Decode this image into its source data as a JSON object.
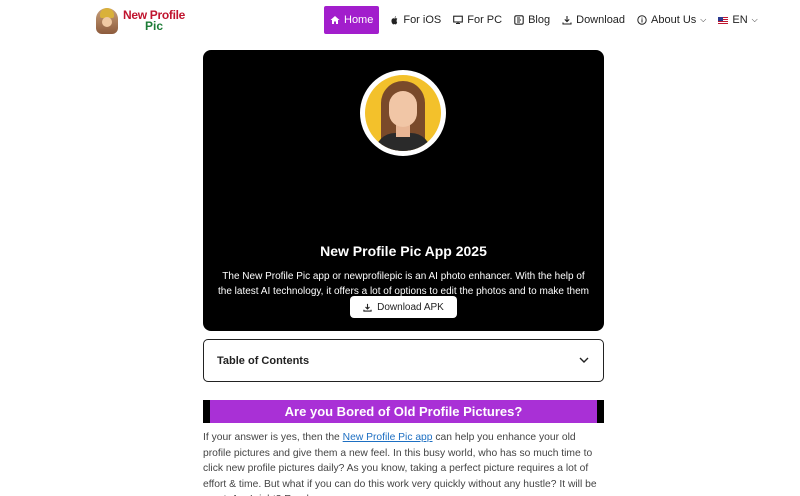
{
  "header": {
    "logo": {
      "line1": "New Profile",
      "line2": "Pic"
    },
    "nav": [
      {
        "label": "Home",
        "icon": "home-icon"
      },
      {
        "label": "For iOS",
        "icon": "apple-icon"
      },
      {
        "label": "For PC",
        "icon": "monitor-icon"
      },
      {
        "label": "Blog",
        "icon": "blog-icon"
      },
      {
        "label": "Download",
        "icon": "download-icon"
      },
      {
        "label": "About Us",
        "icon": "info-icon"
      },
      {
        "label": "EN",
        "icon": "us-flag-icon"
      }
    ]
  },
  "hero": {
    "title": "New Profile Pic App 2025",
    "description": "The New Profile Pic app or newprofilepic is an AI photo enhancer. With the help of the latest AI technology, it offers a lot of options to edit the photos and to make them outstanding.",
    "button_label": "Download APK"
  },
  "toc": {
    "title": "Table of Contents"
  },
  "section": {
    "heading": "Are you Bored of Old Profile Pictures?",
    "para_before_link": "If your answer is yes, then the ",
    "link_text": "New Profile Pic app",
    "para_after_link": " can help you enhance your old profile pictures and give them a new feel. In this busy world, who has so much time to click new profile pictures daily? As you know, taking a perfect picture requires a lot of effort & time. But what if you can do this work very quickly without any hustle? It will be great, Am I right? Read"
  },
  "colors": {
    "accent": "#a21ecc",
    "heading_bg": "#a930d6",
    "hero_bg": "#000000"
  }
}
